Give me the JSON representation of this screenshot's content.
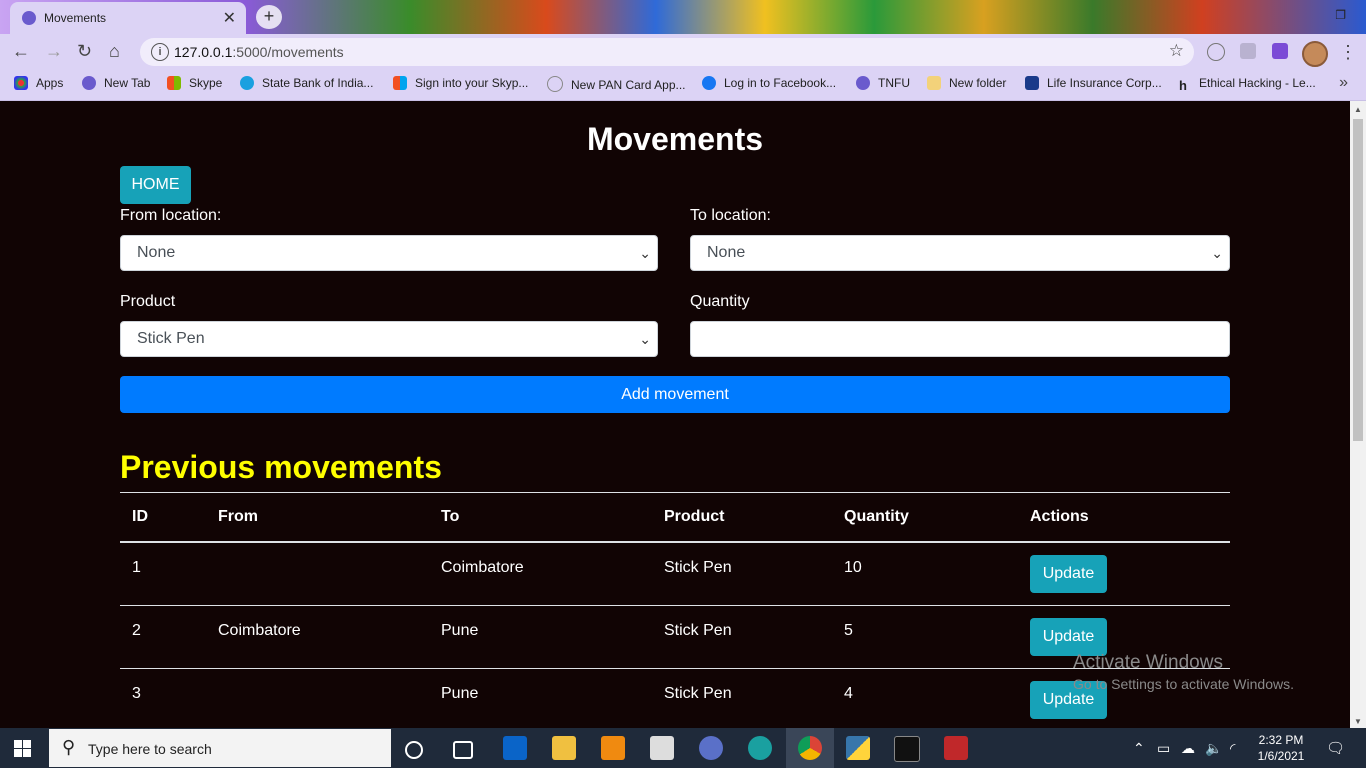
{
  "browser": {
    "tab_title": "Movements",
    "tab_close": "✕",
    "new_tab": "+",
    "url_host": "127.0.0.1",
    "url_path": ":5000/movements",
    "bookmarks": [
      "Apps",
      "New Tab",
      "Skype",
      "State Bank of India...",
      "Sign into your Skyp...",
      "New PAN Card App...",
      "Log in to Facebook...",
      "TNFU",
      "New folder",
      "Life Insurance Corp...",
      "Ethical Hacking - Le..."
    ],
    "bookmarks_more": "»"
  },
  "page": {
    "title": "Movements",
    "home_label": "HOME",
    "from_label": "From location:",
    "from_value": "None",
    "to_label": "To location:",
    "to_value": "None",
    "product_label": "Product",
    "product_value": "Stick Pen",
    "quantity_label": "Quantity",
    "quantity_value": "",
    "add_label": "Add movement",
    "previous_heading": "Previous movements",
    "table": {
      "headers": [
        "ID",
        "From",
        "To",
        "Product",
        "Quantity",
        "Actions"
      ],
      "rows": [
        {
          "id": "1",
          "from": "",
          "to": "Coimbatore",
          "product": "Stick Pen",
          "quantity": "10",
          "action": "Update"
        },
        {
          "id": "2",
          "from": "Coimbatore",
          "to": "Pune",
          "product": "Stick Pen",
          "quantity": "5",
          "action": "Update"
        },
        {
          "id": "3",
          "from": "",
          "to": "Pune",
          "product": "Stick Pen",
          "quantity": "4",
          "action": "Update"
        }
      ]
    },
    "watermark_title": "Activate Windows",
    "watermark_sub": "Go to Settings to activate Windows."
  },
  "taskbar": {
    "search_placeholder": "Type here to search",
    "time": "2:32 PM",
    "date": "1/6/2021"
  },
  "colors": {
    "page_bg": "#110404",
    "heading_yellow": "#ffff00",
    "info_button": "#17a2b8",
    "primary_button": "#007bff"
  }
}
